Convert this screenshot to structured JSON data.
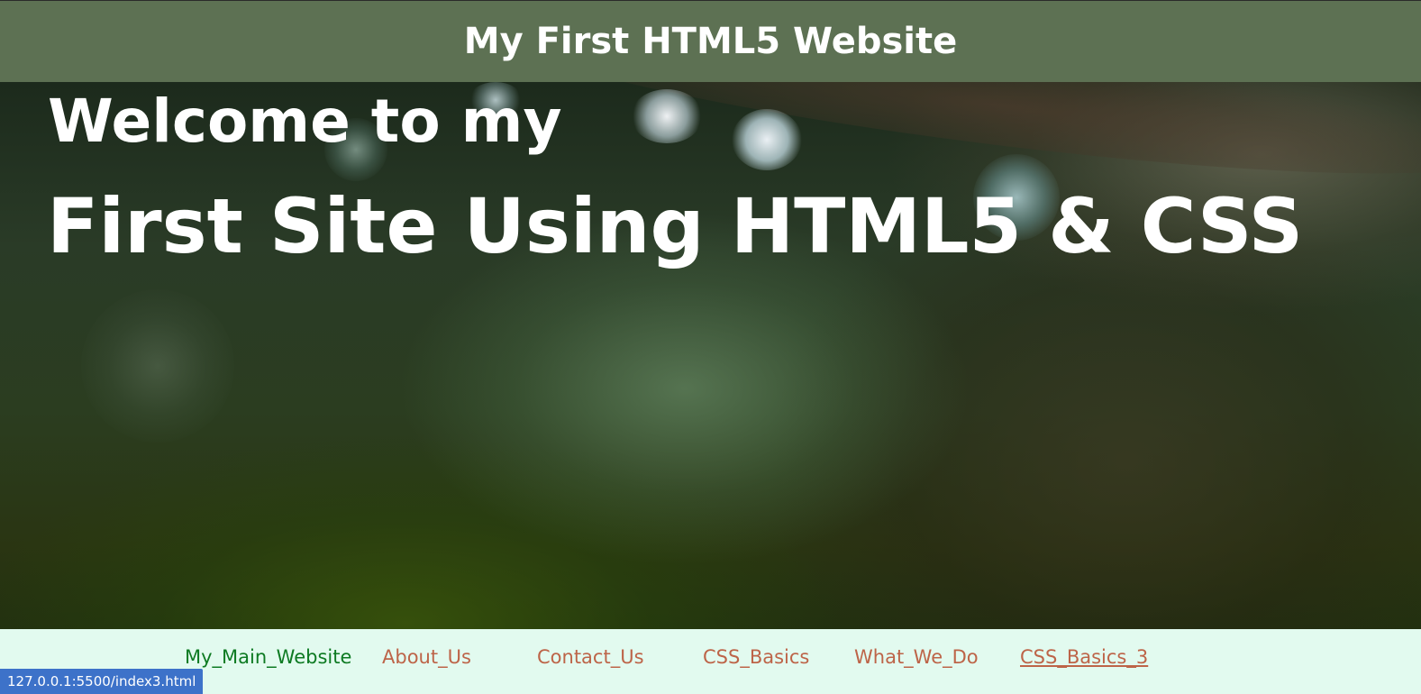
{
  "header": {
    "title": "My First HTML5 Website"
  },
  "hero": {
    "line1": "Welcome to my",
    "line2": "First Site Using HTML5 & CSS"
  },
  "nav": {
    "links": [
      {
        "label": "My_Main_Website"
      },
      {
        "label": "About_Us"
      },
      {
        "label": "Contact_Us"
      },
      {
        "label": "CSS_Basics"
      },
      {
        "label": "What_We_Do"
      },
      {
        "label": "CSS_Basics_3"
      }
    ]
  },
  "status_bar": {
    "url": "127.0.0.1:5500/index3.html"
  },
  "colors": {
    "header_bg": "#5d7153",
    "nav_bg": "#e2faef",
    "nav_link": "#bd6448",
    "nav_home_link": "#0d7a22",
    "status_bg": "#3d72c9"
  }
}
